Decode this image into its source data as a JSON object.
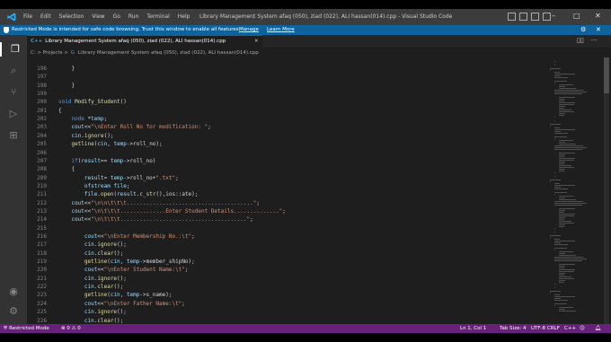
{
  "titlebar": {
    "menu": [
      "File",
      "Edit",
      "Selection",
      "View",
      "Go",
      "Run",
      "Terminal",
      "Help"
    ],
    "title": "Library Management System afaq (050), ziad (022), ALI hassan(014).cpp - Visual Studio Code",
    "minimize": "–",
    "maximize": "□",
    "close": "✕"
  },
  "banner": {
    "message": "Restricted Mode is intended for safe code browsing. Trust this window to enable all features.",
    "manage": "Manage",
    "learn_more": "Learn More",
    "gear": "⚙",
    "close": "✕"
  },
  "tab": {
    "icon": "C++",
    "filename": "Library Management System afaq (050), ziad (022), ALI hassan(014).cpp",
    "close": "✕"
  },
  "tab_actions": {
    "split": "▯▯",
    "more": "···"
  },
  "breadcrumb": {
    "path": "C: > Projects > ",
    "file": "Library Management System afaq (050), ziad (022), ALI hassan(014).cpp"
  },
  "code_lines": [
    {
      "n": "196",
      "t": "    }"
    },
    {
      "n": "197",
      "t": ""
    },
    {
      "n": "198",
      "t": "    }"
    },
    {
      "n": "199",
      "t": ""
    },
    {
      "n": "200",
      "t": "void Modify_Student()"
    },
    {
      "n": "201",
      "t": "{"
    },
    {
      "n": "202",
      "t": "    node *temp;"
    },
    {
      "n": "203",
      "t": "    cout<<\"\\nEnter Roll No for modification: \";"
    },
    {
      "n": "204",
      "t": "    cin.ignore();"
    },
    {
      "n": "205",
      "t": "    getline(cin, temp->roll_no);"
    },
    {
      "n": "206",
      "t": ""
    },
    {
      "n": "207",
      "t": "    if(result== temp->roll_no)"
    },
    {
      "n": "208",
      "t": "    {"
    },
    {
      "n": "209",
      "t": "        result= temp->roll_no+\".txt\";"
    },
    {
      "n": "210",
      "t": "        ofstream file;"
    },
    {
      "n": "211",
      "t": "        file.open(result.c_str(),ios::ate);"
    },
    {
      "n": "212",
      "t": "    cout<<\"\\n\\n\\t\\t\\t.......................................\";"
    },
    {
      "n": "213",
      "t": "    cout<<\"\\n\\t\\t\\t..............Enter Student Details..............\";"
    },
    {
      "n": "214",
      "t": "    cout<<\"\\n\\t\\t\\t.......................................\";"
    },
    {
      "n": "215",
      "t": ""
    },
    {
      "n": "216",
      "t": "        cout<<\"\\nEnter Membership No.:\\t\";"
    },
    {
      "n": "217",
      "t": "        cin.ignore();"
    },
    {
      "n": "218",
      "t": "        cin.clear();"
    },
    {
      "n": "219",
      "t": "        getline(cin, temp->member_shipNo);"
    },
    {
      "n": "220",
      "t": "        cout<<\"\\nEnter Student Name:\\t\";"
    },
    {
      "n": "221",
      "t": "        cin.ignore();"
    },
    {
      "n": "222",
      "t": "        cin.clear();"
    },
    {
      "n": "223",
      "t": "        getline(cin, temp->s_name);"
    },
    {
      "n": "224",
      "t": "        cout<<\"\\nEnter Father Name:\\t\";"
    },
    {
      "n": "225",
      "t": "        cin.ignore();"
    },
    {
      "n": "226",
      "t": "        cin.clear();"
    }
  ],
  "statusbar": {
    "restricted": "Restricted Mode",
    "errors": "0",
    "warnings": "0",
    "position": "Ln 1, Col 1",
    "tab_size": "Tab Size: 4",
    "encoding": "UTF-8",
    "eol": "CRLF",
    "language": "C++"
  },
  "colors": {
    "titlebar": "#3c3c3c",
    "banner": "#0e639c",
    "statusbar": "#68217a",
    "editor_bg": "#1e1e1e",
    "activity_bar": "#333333"
  },
  "activity_icons": [
    "explorer-icon",
    "search-icon",
    "source-control-icon",
    "run-debug-icon",
    "extensions-icon",
    "account-icon",
    "manage-gear-icon"
  ]
}
